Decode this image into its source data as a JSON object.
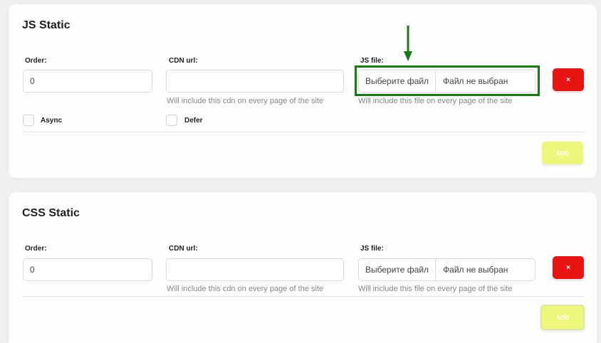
{
  "js_static": {
    "title": "JS Static",
    "order_label": "Order:",
    "order_value": "0",
    "cdn_label": "CDN url:",
    "cdn_value": "",
    "cdn_help": "Will include this cdn on every page of the site",
    "file_label": "JS file:",
    "file_choose": "Выберите файл",
    "file_name": "Файл не выбран",
    "file_help": "Will include this file on every page of the site",
    "delete_label": "×",
    "async_label": "Async",
    "defer_label": "Defer",
    "add_label": "ADD"
  },
  "css_static": {
    "title": "CSS Static",
    "order_label": "Order:",
    "order_value": "0",
    "cdn_label": "CDN url:",
    "cdn_value": "",
    "cdn_help": "Will include this cdn on every page of the site",
    "file_label": "JS file:",
    "file_choose": "Выберите файл",
    "file_name": "Файл не выбран",
    "file_help": "Will include this file on every page of the site",
    "delete_label": "×",
    "add_label": "ADD"
  },
  "colors": {
    "delete": "#e81414",
    "add": "#eef77b",
    "highlight": "#137d13"
  }
}
